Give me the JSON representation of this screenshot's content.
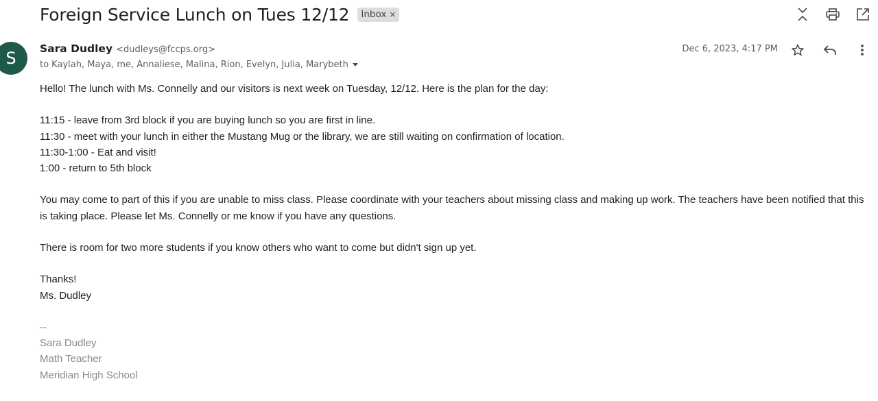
{
  "email": {
    "subject": "Foreign Service Lunch on Tues 12/12",
    "label": "Inbox",
    "label_remove": "×",
    "sender": {
      "initial": "S",
      "name": "Sara Dudley",
      "email": "<dudleys@fccps.org>"
    },
    "recipients": "to Kaylah, Maya, me, Annaliese, Malina, Rion, Evelyn, Julia, Marybeth",
    "date": "Dec 6, 2023, 4:17 PM",
    "body": {
      "greeting": "Hello!  The lunch with Ms. Connelly and our visitors is next week on Tuesday, 12/12.  Here is the plan for the day:",
      "schedule": [
        "11:15 - leave from 3rd block if you are buying lunch so you are first in line.",
        "11:30 - meet with your lunch in either the Mustang Mug or the library, we are still waiting on confirmation of location.",
        "11:30-1:00 - Eat and visit!",
        "1:00 - return to 5th block"
      ],
      "paragraph1": "You may come to part of this if you are unable to miss class.  Please coordinate with your teachers about missing class and making up work.  The teachers have been notified that this is taking place.  Please let Ms. Connelly or me know if you have any questions.",
      "paragraph2": "There is room for two more students if you know others who want to come but didn't sign up yet.",
      "closing": "Thanks!",
      "signoff": "Ms. Dudley"
    },
    "signature": {
      "separator": "--",
      "name": "Sara Dudley",
      "title": "Math Teacher",
      "school": "Meridian High School"
    }
  },
  "icons": {
    "expand_collapse": "unfold-less-icon",
    "print": "print-icon",
    "open_new_window": "open-in-new-icon",
    "star": "star-icon",
    "reply": "reply-icon",
    "more": "more-vert-icon",
    "recipients_caret": "caret-down-icon"
  },
  "colors": {
    "avatar_bg": "#1e5a4a",
    "chip_bg": "#dddddd",
    "signature_text": "#888888"
  }
}
